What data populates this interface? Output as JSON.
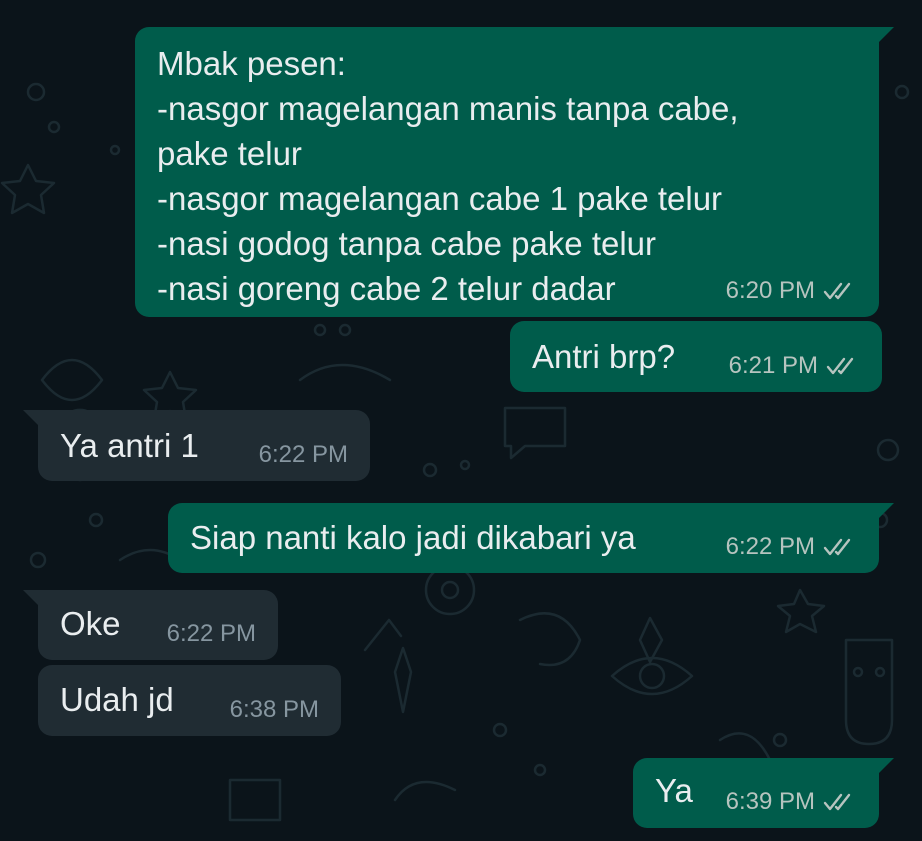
{
  "messages": [
    {
      "direction": "outgoing",
      "text": "Mbak pesen:\n-nasgor magelangan manis tanpa cabe,\npake telur\n-nasgor magelangan cabe 1 pake telur\n-nasi godog tanpa cabe pake telur\n-nasi goreng cabe 2 telur dadar",
      "time": "6:20 PM",
      "status": "read-double-tick-icon"
    },
    {
      "direction": "outgoing",
      "text": "Antri brp?",
      "time": "6:21 PM",
      "status": "read-double-tick-icon"
    },
    {
      "direction": "incoming",
      "text": "Ya antri 1",
      "time": "6:22 PM"
    },
    {
      "direction": "outgoing",
      "text": "Siap nanti kalo jadi dikabari ya",
      "time": "6:22 PM",
      "status": "read-double-tick-icon"
    },
    {
      "direction": "incoming",
      "text": "Oke",
      "time": "6:22 PM"
    },
    {
      "direction": "incoming",
      "text": "Udah jd",
      "time": "6:38 PM"
    },
    {
      "direction": "outgoing",
      "text": "Ya",
      "time": "6:39 PM",
      "status": "read-double-tick-icon"
    }
  ],
  "colors": {
    "background": "#0b141a",
    "outgoing_bubble": "#005c4b",
    "incoming_bubble": "#202c33",
    "message_text": "#e9edef",
    "outgoing_meta": "#b6c4bf",
    "incoming_meta": "#8696a0"
  }
}
